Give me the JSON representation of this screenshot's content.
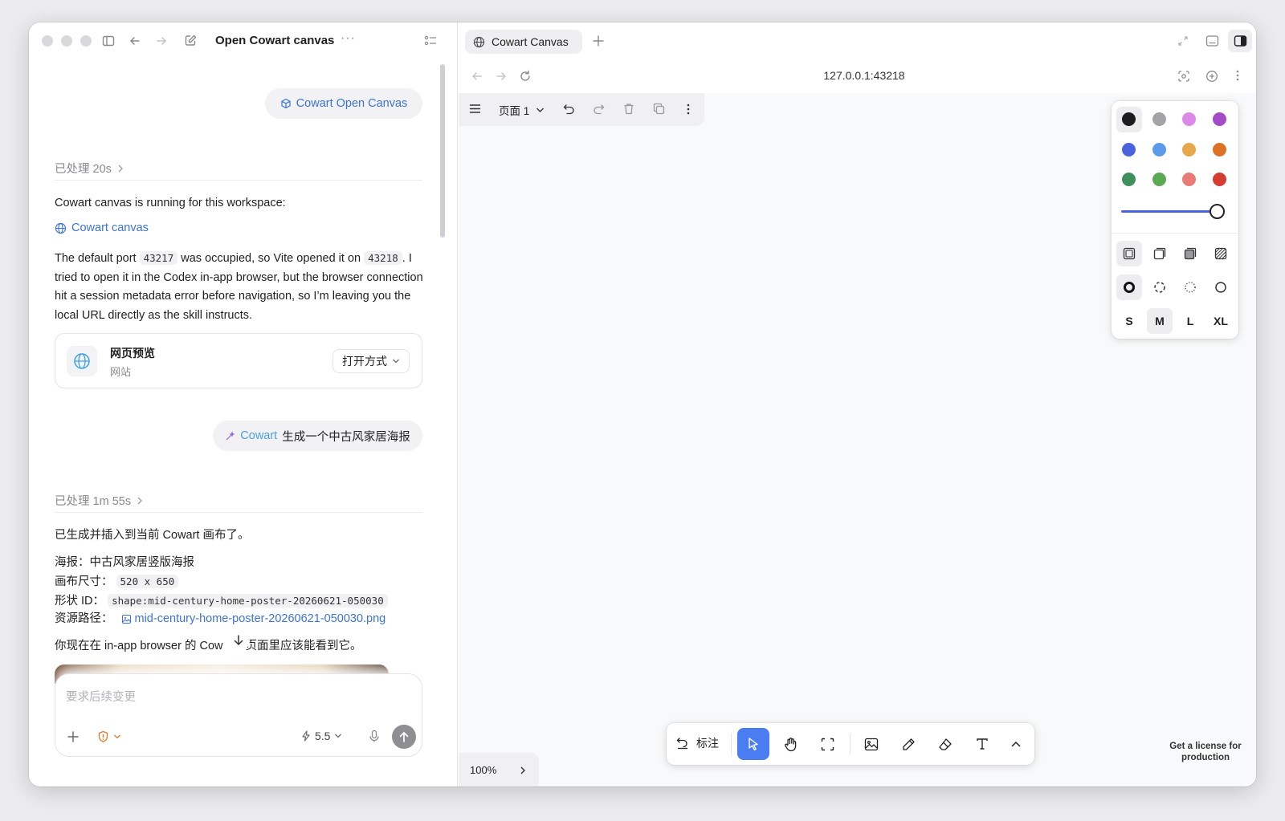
{
  "chat": {
    "title": "Open Cowart canvas",
    "skill_chip": "Cowart Open Canvas",
    "processed_1": "已处理 20s",
    "intro": "Cowart canvas is running for this workspace:",
    "canvas_link": "Cowart canvas",
    "p1_a": "The default port ",
    "p1_code1": "43217",
    "p1_b": " was occupied, so Vite opened it on ",
    "p1_code2": "43218",
    "p1_c": ". I tried to open it in the Codex in-app browser, but the browser connection hit a session metadata error before navigation, so I’m leaving you the local URL directly as the skill instructs.",
    "preview_card": {
      "title": "网页预览",
      "subtitle": "网站",
      "open_with": "打开方式"
    },
    "user_msg_prefix": "Cowart",
    "user_msg": "生成一个中古风家居海报",
    "processed_2": "已处理 1m 55s",
    "done_line": "已生成并插入到当前 Cowart 画布了。",
    "poster_label": "海报：",
    "poster_value": "中古风家居竖版海报",
    "size_label": "画布尺寸：",
    "size_value": "520 x 650",
    "shape_label": "形状 ID：",
    "shape_value": "shape:mid-century-home-poster-20260621-050030",
    "asset_label": "资源路径：",
    "asset_value": "mid-century-home-poster-20260621-050030.png",
    "tail_a": "你现在在 in-app browser 的 Cow",
    "tail_b": "页面里应该能看到它。",
    "composer": {
      "placeholder": "要求后续变更",
      "model": "5.5"
    }
  },
  "browser": {
    "tab_title": "Cowart Canvas",
    "url": "127.0.0.1:43218",
    "page_label": "页面 1",
    "zoom": "100%",
    "annotate_label": "标注",
    "license": "Get a license for production",
    "sizes": [
      "S",
      "M",
      "L",
      "XL"
    ],
    "selected_size": "M",
    "colors": [
      "#1d1d1f",
      "#a2a4a8",
      "#dc8ae8",
      "#a44bc8",
      "#4a63dd",
      "#5b9bea",
      "#e6a84a",
      "#dd7226",
      "#3f8f5c",
      "#5ba955",
      "#e77c76",
      "#d63d31"
    ],
    "accent": "#4a7cf2"
  }
}
